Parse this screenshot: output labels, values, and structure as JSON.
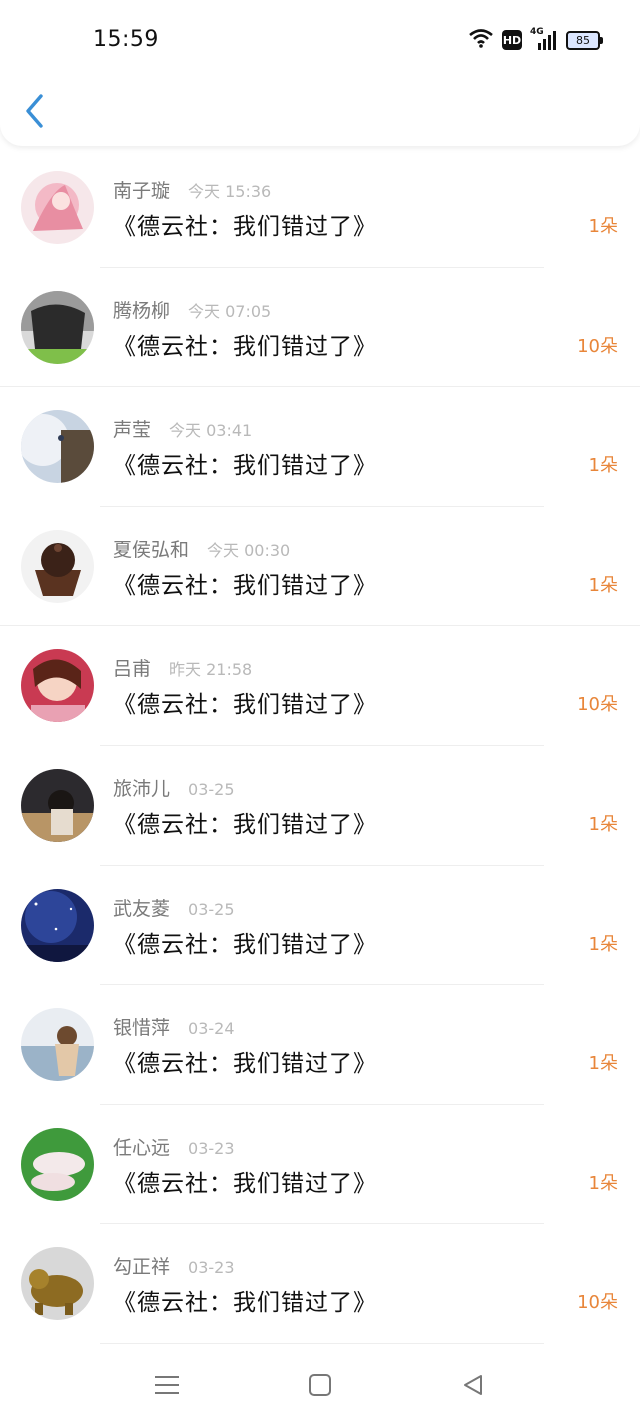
{
  "status_bar": {
    "time": "15:59",
    "network": "4G",
    "hd": "HD",
    "battery": "85",
    "icons": [
      "wifi-icon",
      "hd-icon",
      "signal-icon",
      "battery-icon"
    ]
  },
  "header": {
    "back_icon": "chevron-left-icon"
  },
  "accent_colors": {
    "back": "#3a8fd6",
    "count": "#e8863a",
    "name": "#7a7a7a",
    "time": "#b9b9b9"
  },
  "list": [
    {
      "name": "南子璇",
      "time": "今天 15:36",
      "title": "《德云社：我们错过了》",
      "count": "1朵"
    },
    {
      "name": "腾杨柳",
      "time": "今天 07:05",
      "title": "《德云社：我们错过了》",
      "count": "10朵"
    },
    {
      "name": "声莹",
      "time": "今天 03:41",
      "title": "《德云社：我们错过了》",
      "count": "1朵"
    },
    {
      "name": "夏侯弘和",
      "time": "今天 00:30",
      "title": "《德云社：我们错过了》",
      "count": "1朵"
    },
    {
      "name": "吕甫",
      "time": "昨天 21:58",
      "title": "《德云社：我们错过了》",
      "count": "10朵"
    },
    {
      "name": "旅沛儿",
      "time": "03-25",
      "title": "《德云社：我们错过了》",
      "count": "1朵"
    },
    {
      "name": "武友菱",
      "time": "03-25",
      "title": "《德云社：我们错过了》",
      "count": "1朵"
    },
    {
      "name": "银惜萍",
      "time": "03-24",
      "title": "《德云社：我们错过了》",
      "count": "1朵"
    },
    {
      "name": "任心远",
      "time": "03-23",
      "title": "《德云社：我们错过了》",
      "count": "1朵"
    },
    {
      "name": "勾正祥",
      "time": "03-23",
      "title": "《德云社：我们错过了》",
      "count": "10朵"
    }
  ],
  "nav_bar": {
    "icons": [
      "menu-icon",
      "home-square-icon",
      "back-triangle-icon"
    ]
  }
}
